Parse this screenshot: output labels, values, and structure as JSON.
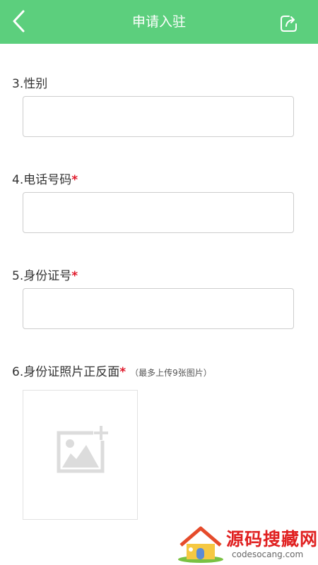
{
  "header": {
    "title": "申请入驻",
    "color": "#5ccf7d"
  },
  "form": {
    "gender": {
      "label": "3.性别",
      "value": "",
      "required": false
    },
    "phone": {
      "label": "4.电话号码",
      "required_mark": "*",
      "value": ""
    },
    "id_number": {
      "label": "5.身份证号",
      "required_mark": "*",
      "value": ""
    },
    "id_photos": {
      "label": "6.身份证照片正反面",
      "required_mark": "*",
      "hint": "（最多上传9张图片）",
      "upload_icon": "add-image-icon"
    }
  },
  "icons": {
    "back": "chevron-left-icon",
    "share": "share-icon"
  },
  "watermark": {
    "text": "源码搜藏网",
    "url": "codesocang.com"
  },
  "colors": {
    "required": "#e0182a",
    "border": "#cdcdcd"
  }
}
